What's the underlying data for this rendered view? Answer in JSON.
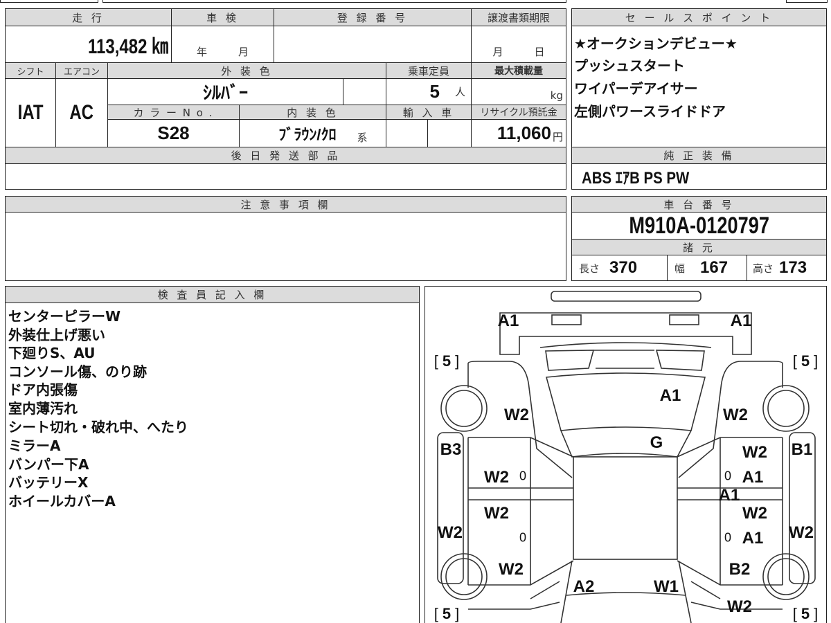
{
  "main": {
    "mileage_header": "走 行",
    "mileage": "113,482 ㎞",
    "shaken_header": "車 検",
    "shaken_year": "年",
    "shaken_month": "月",
    "reg_header": "登 録 番 号",
    "transfer_header": "譲渡書類期限",
    "transfer_month": "月",
    "transfer_day": "日",
    "shift_header": "シフト",
    "ac_header": "エアコン",
    "color_header": "外 装 色",
    "capacity_header": "乗車定員",
    "maxload_header": "最大積載量",
    "shift": "IAT",
    "ac": "AC",
    "color": "ｼﾙﾊﾞｰ",
    "capacity": "5",
    "capacity_unit": "人",
    "maxload_unit": "kg",
    "colorno_header": "カ ラ ー N o .",
    "interior_header": "内 装 色",
    "import_header": "輸 入 車",
    "recycle_header": "リサイクル預託金",
    "colorno": "S28",
    "interior": "ﾌﾞﾗｳﾝ/ｸﾛ",
    "interior_suffix": "系",
    "recycle": "11,060",
    "recycle_unit": "円",
    "parts_header": "後 日 発 送 部 品"
  },
  "sales": {
    "header": "セ ー ル ス ポ イ ン ト",
    "points": [
      "★オークションデビュー★",
      "プッシュスタート",
      "ワイパーデアイサー",
      "左側パワースライドドア"
    ]
  },
  "equipment": {
    "header": "純 正 装 備",
    "value": "ABS ｴｱB PS PW"
  },
  "notes": {
    "header": "注 意 事 項 欄"
  },
  "chassis": {
    "header": "車 台 番 号",
    "value": "M910A-0120797",
    "spec_header": "諸 元",
    "length_label": "長さ",
    "length": "370",
    "width_label": "幅",
    "width": "167",
    "height_label": "高さ",
    "height": "173"
  },
  "inspector": {
    "header": "検 査 員 記 入 欄",
    "lines": [
      "センターピラーW",
      "外装仕上げ悪い",
      "下廻りS、AU",
      "コンソール傷、のり跡",
      "ドア内張傷",
      "室内薄汚れ",
      "シート切れ・破れ中、へたり",
      "ミラーA",
      "バンパー下A",
      "バッテリーX",
      "ホイールカバーA"
    ]
  },
  "diagram": {
    "tread_fl": "5",
    "tread_fr": "5",
    "tread_rl": "5",
    "tread_rr": "5",
    "marks": [
      "A1",
      "A1",
      "A1",
      "W2",
      "W2",
      "G",
      "B3",
      "B1",
      "W2",
      "W2",
      "A1",
      "A1",
      "W2",
      "W2",
      "W2",
      "A1",
      "W2",
      "W2",
      "B2",
      "A2",
      "W1",
      "W2"
    ],
    "zero": "0"
  }
}
